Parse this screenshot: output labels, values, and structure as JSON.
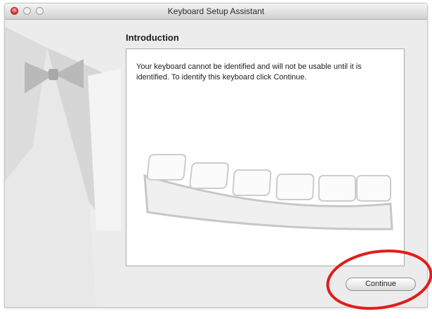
{
  "window": {
    "title": "Keyboard Setup Assistant",
    "traffic_lights": [
      "close",
      "minimize",
      "zoom"
    ]
  },
  "page": {
    "heading": "Introduction",
    "message": "Your keyboard cannot be identified and will not be usable until it is identified. To identify this keyboard click Continue."
  },
  "buttons": {
    "continue_label": "Continue"
  },
  "annotation": {
    "target": "continue-button",
    "color": "#e21c1c"
  },
  "icons": [
    "tuxedo-illustration",
    "keyboard-illustration"
  ],
  "colors": {
    "window_bg": "#ececec",
    "close_button": "#c8332b",
    "annotation": "#e21c1c"
  }
}
